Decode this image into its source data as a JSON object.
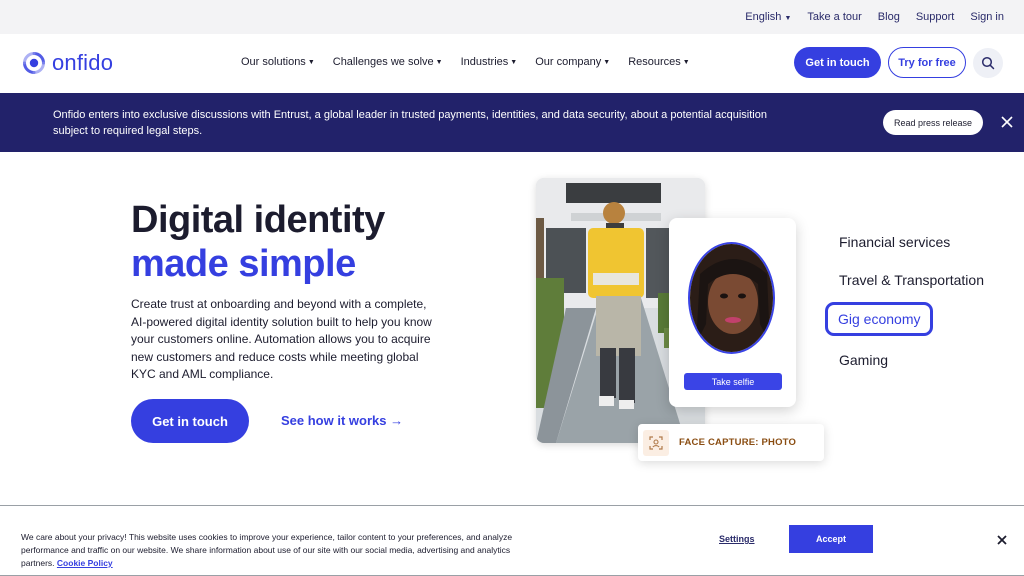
{
  "utility_bar": {
    "language": "English",
    "take_tour": "Take a tour",
    "blog": "Blog",
    "support": "Support",
    "sign_in": "Sign in"
  },
  "header": {
    "logo_text": "onfido",
    "menu": [
      {
        "label": "Our solutions"
      },
      {
        "label": "Challenges we solve"
      },
      {
        "label": "Industries"
      },
      {
        "label": "Our company"
      },
      {
        "label": "Resources"
      }
    ],
    "get_in_touch": "Get in touch",
    "try_free": "Try for free",
    "search_icon": "search-icon"
  },
  "banner": {
    "text": "Onfido enters into exclusive discussions with Entrust, a global leader in trusted payments, identities, and data security, about a potential acquisition subject to required legal steps.",
    "button": "Read press release",
    "close_icon": "close-icon"
  },
  "hero": {
    "title_line1": "Digital identity",
    "title_line2": "made simple",
    "description": "Create trust at onboarding and beyond with a complete, AI-powered digital identity solution built to help you know your customers online.  Automation allows you to acquire new customers and reduce costs while meeting global KYC and AML compliance.",
    "cta": "Get in touch",
    "link": "See how it works →"
  },
  "visual": {
    "selfie_button": "Take selfie",
    "capture_label": "FACE CAPTURE: PHOTO"
  },
  "industries": [
    "Financial services",
    "Travel & Transportation",
    "Gig economy",
    "Gaming"
  ],
  "cookie": {
    "text": "We care about your privacy! This website uses cookies to improve your experience, tailor content to your preferences, and analyze performance and traffic on our website. We share information about use of our site with our social media, advertising and analytics partners.",
    "policy_link": "Cookie Policy",
    "settings": "Settings",
    "accept": "Accept"
  },
  "colors": {
    "brand": "#353fe0",
    "banner_bg": "#22226a",
    "capture_text": "#8a4d12"
  }
}
